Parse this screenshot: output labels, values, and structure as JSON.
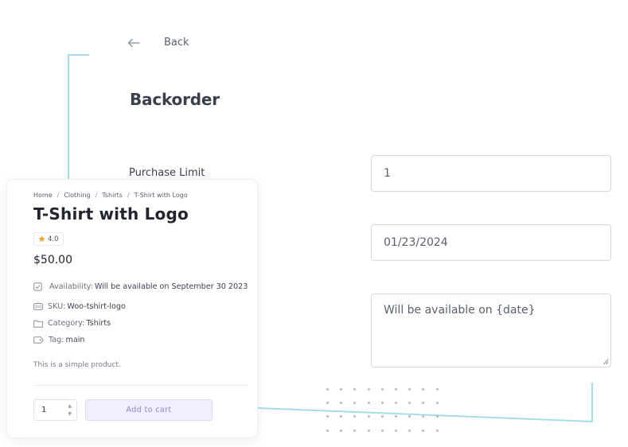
{
  "nav": {
    "back_label": "Back"
  },
  "page": {
    "title": "Backorder"
  },
  "form": {
    "purchase_limit_label": "Purchase Limit",
    "purchase_limit_value": "1",
    "date_value": "01/23/2024",
    "message_value": "Will be available on {date}"
  },
  "product": {
    "breadcrumb": [
      "Home",
      "Clothing",
      "Tshirts",
      "T-Shirt with Logo"
    ],
    "breadcrumb_separator": "/",
    "title": "T-Shirt with Logo",
    "rating": "4.0",
    "price": "$50.00",
    "availability_label": "Availability:",
    "availability_value": "Will be available on September 30 2023",
    "sku_label": "SKU:",
    "sku_value": "Woo-tshirt-logo",
    "category_label": "Category:",
    "category_value": "Tshirts",
    "tag_label": "Tag:",
    "tag_value": "main",
    "description": "This is a simple product.",
    "quantity": "1",
    "add_to_cart_label": "Add to cart"
  },
  "colors": {
    "accent_line": "#a6dee6",
    "star": "#f5a623",
    "add_to_cart_bg": "#f1effd",
    "add_to_cart_text": "#8d86c9"
  }
}
